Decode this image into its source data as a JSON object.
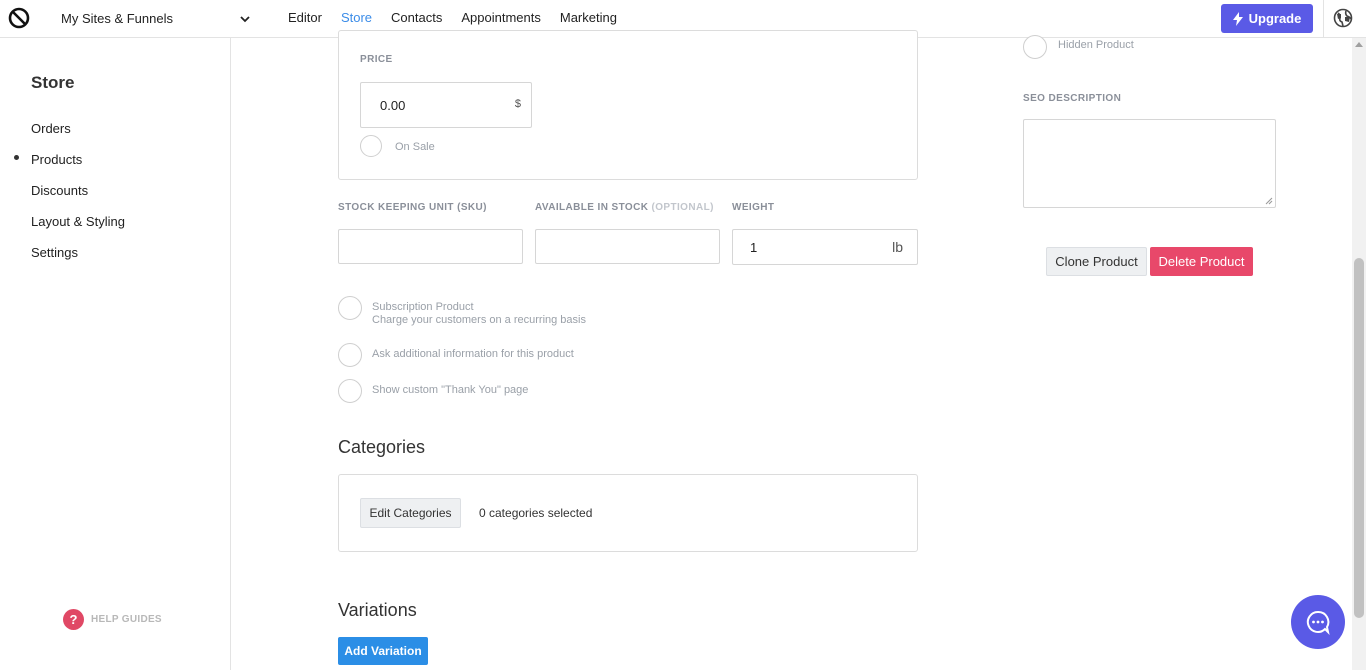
{
  "topbar": {
    "site_select": "My Sites & Funnels",
    "nav": [
      "Editor",
      "Store",
      "Contacts",
      "Appointments",
      "Marketing"
    ],
    "active_nav": "Store",
    "upgrade_label": "Upgrade",
    "accent": "#5a5ae6"
  },
  "sidebar": {
    "title": "Store",
    "items": [
      "Orders",
      "Products",
      "Discounts",
      "Layout & Styling",
      "Settings"
    ],
    "active_item": "Products",
    "help_label": "HELP GUIDES"
  },
  "pricing": {
    "price_label": "PRICE",
    "price_value": "0.00",
    "currency": "$",
    "on_sale_label": "On Sale"
  },
  "inventory": {
    "sku_label": "STOCK KEEPING UNIT (SKU)",
    "stock_label": "AVAILABLE IN STOCK",
    "stock_optional": "(OPTIONAL)",
    "weight_label": "WEIGHT",
    "sku_value": "",
    "stock_value": "",
    "weight_value": "1",
    "weight_unit": "lb"
  },
  "options": {
    "subscription_title": "Subscription Product",
    "subscription_desc": "Charge your customers on a recurring basis",
    "ask_info": "Ask additional information for this product",
    "thank_you": "Show custom \"Thank You\" page"
  },
  "categories": {
    "title": "Categories",
    "edit_label": "Edit Categories",
    "selected_text": "0 categories selected"
  },
  "variations": {
    "title": "Variations",
    "add_label": "Add Variation"
  },
  "right": {
    "hidden_product": "Hidden Product",
    "seo_label": "SEO DESCRIPTION",
    "seo_value": "",
    "clone_label": "Clone Product",
    "delete_label": "Delete Product",
    "delete_color": "#e8486a"
  }
}
